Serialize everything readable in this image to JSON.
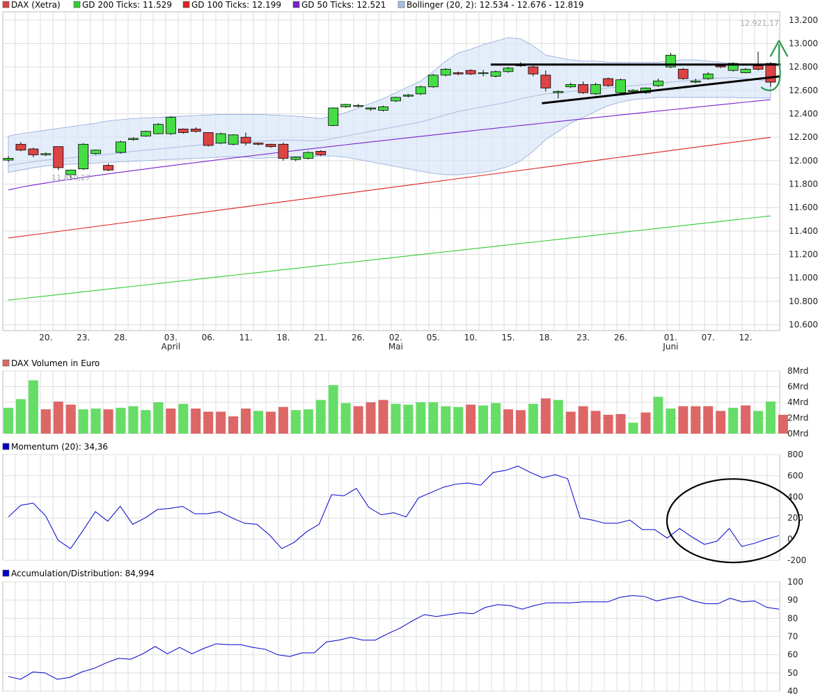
{
  "legend": {
    "dax": {
      "label": "DAX (Xetra)",
      "color": "#dd4444"
    },
    "gd200": {
      "label": "GD 200 Ticks: 11.529",
      "color": "#33cc33"
    },
    "gd100": {
      "label": "GD 100 Ticks: 12.199",
      "color": "#dd2222"
    },
    "gd50": {
      "label": "GD 50 Ticks: 12.521",
      "color": "#7722cc"
    },
    "bollinger": {
      "label": "Bollinger (20, 2): 12.534 - 12.676 - 12.819",
      "color": "#aac0e0"
    }
  },
  "panels": {
    "volume_title": "DAX Volumen in Euro",
    "momentum_title": "Momentum (20): 34,36",
    "ad_title": "Accumulation/Distribution: 84,994"
  },
  "annotations": {
    "high_label": "12.921,17",
    "low_label": "11.850,27"
  },
  "colors": {
    "up": "#44dd44",
    "down": "#dd4444",
    "vol_up": "#66dd66",
    "vol_down": "#dd6666",
    "line_blue": "#0000cc",
    "grid": "#dddddd"
  },
  "chart_data": [
    {
      "type": "candlestick",
      "title": "DAX (Xetra)",
      "x_tick_labels": [
        "20.",
        "23.",
        "28.",
        "03.",
        "06.",
        "11.",
        "18.",
        "21.",
        "26.",
        "02.",
        "05.",
        "10.",
        "15.",
        "18.",
        "23.",
        "26.",
        "01.",
        "07.",
        "12."
      ],
      "x_tick_index": [
        3,
        6,
        9,
        13,
        16,
        19,
        22,
        25,
        28,
        31,
        34,
        37,
        40,
        43,
        46,
        49,
        53,
        56,
        59
      ],
      "month_labels": [
        {
          "label": "April",
          "index": 13
        },
        {
          "label": "Mai",
          "index": 31
        },
        {
          "label": "Juni",
          "index": 53
        }
      ],
      "y_ticks": [
        "13.200",
        "13.000",
        "12.800",
        "12.600",
        "12.400",
        "12.200",
        "12.000",
        "11.800",
        "11.600",
        "11.400",
        "11.200",
        "11.000",
        "10.800",
        "10.600"
      ],
      "ylim": [
        10550,
        13270
      ],
      "open": [
        12005,
        12140,
        12100,
        12050,
        12120,
        11880,
        11930,
        12060,
        11960,
        12070,
        12180,
        12210,
        12230,
        12230,
        12270,
        12270,
        12240,
        12150,
        12140,
        12200,
        12150,
        12140,
        12140,
        12010,
        12020,
        12080,
        12300,
        12460,
        12470,
        12440,
        12430,
        12510,
        12550,
        12570,
        12630,
        12730,
        12750,
        12770,
        12750,
        12720,
        12760,
        12820,
        12800,
        12730,
        12580,
        12630,
        12650,
        12570,
        12700,
        12580,
        12590,
        12580,
        12640,
        12800,
        12780,
        12670,
        12700,
        12810,
        12770,
        12750,
        12810,
        12830
      ],
      "close": [
        12020,
        12090,
        12050,
        12060,
        11940,
        11920,
        12140,
        12090,
        11920,
        12160,
        12190,
        12250,
        12310,
        12370,
        12240,
        12250,
        12130,
        12230,
        12220,
        12150,
        12140,
        12120,
        12020,
        12030,
        12070,
        12050,
        12450,
        12480,
        12470,
        12450,
        12460,
        12540,
        12560,
        12630,
        12730,
        12780,
        12740,
        12740,
        12750,
        12760,
        12790,
        12810,
        12740,
        12620,
        12590,
        12650,
        12580,
        12650,
        12640,
        12690,
        12600,
        12620,
        12680,
        12900,
        12700,
        12680,
        12740,
        12800,
        12830,
        12780,
        12780,
        12670
      ],
      "high": [
        12040,
        12160,
        12110,
        12070,
        12120,
        11900,
        12150,
        12095,
        11975,
        12170,
        12200,
        12255,
        12320,
        12380,
        12275,
        12285,
        12240,
        12240,
        12225,
        12240,
        12155,
        12145,
        12155,
        12035,
        12080,
        12090,
        12455,
        12485,
        12485,
        12455,
        12470,
        12545,
        12570,
        12640,
        12740,
        12790,
        12760,
        12780,
        12775,
        12770,
        12800,
        12840,
        12810,
        12770,
        12600,
        12665,
        12675,
        12665,
        12710,
        12700,
        12610,
        12625,
        12700,
        12920,
        12790,
        12700,
        12755,
        12820,
        12840,
        12790,
        12930,
        12840
      ],
      "low": [
        11990,
        12080,
        12030,
        12040,
        11920,
        11850,
        11920,
        12050,
        11910,
        12060,
        12170,
        12205,
        12225,
        12220,
        12230,
        12240,
        12120,
        12140,
        12130,
        12130,
        12130,
        12110,
        12000,
        11995,
        12010,
        12040,
        12295,
        12450,
        12455,
        12425,
        12420,
        12500,
        12540,
        12560,
        12620,
        12720,
        12730,
        12730,
        12720,
        12710,
        12750,
        12800,
        12720,
        12590,
        12530,
        12620,
        12570,
        12560,
        12630,
        12570,
        12580,
        12570,
        12630,
        12790,
        12690,
        12660,
        12690,
        12790,
        12760,
        12745,
        12770,
        12630
      ],
      "overlays": [
        {
          "name": "GD 200 Ticks",
          "from": 10810,
          "to": 11529
        },
        {
          "name": "GD 100 Ticks",
          "from": 11340,
          "to": 12199
        },
        {
          "name": "GD 50 Ticks",
          "from": 11750,
          "to": 12521
        }
      ],
      "bollinger_mid": [
        11960,
        11975,
        11990,
        12005,
        12015,
        12025,
        12035,
        12045,
        12055,
        12065,
        12080,
        12090,
        12100,
        12110,
        12120,
        12130,
        12140,
        12150,
        12160,
        12165,
        12165,
        12170,
        12175,
        12175,
        12170,
        12170,
        12190,
        12210,
        12230,
        12250,
        12270,
        12290,
        12310,
        12330,
        12360,
        12390,
        12420,
        12440,
        12460,
        12480,
        12500,
        12530,
        12550,
        12570,
        12580,
        12590,
        12600,
        12610,
        12620,
        12630,
        12640,
        12650,
        12660,
        12670,
        12680,
        12690,
        12700,
        12705,
        12710,
        12700,
        12690,
        12676
      ],
      "bollinger_upper": [
        12210,
        12230,
        12245,
        12260,
        12275,
        12290,
        12305,
        12320,
        12340,
        12350,
        12360,
        12365,
        12370,
        12375,
        12380,
        12385,
        12390,
        12395,
        12395,
        12395,
        12395,
        12390,
        12385,
        12380,
        12370,
        12360,
        12380,
        12410,
        12450,
        12490,
        12530,
        12580,
        12630,
        12680,
        12760,
        12850,
        12920,
        12950,
        12990,
        13020,
        13050,
        13040,
        12980,
        12900,
        12880,
        12860,
        12850,
        12850,
        12840,
        12840,
        12840,
        12840,
        12840,
        12850,
        12860,
        12860,
        12850,
        12840,
        12830,
        12820,
        12820,
        12819
      ],
      "bollinger_lower": [
        11900,
        11920,
        11940,
        11955,
        11965,
        11970,
        11975,
        11980,
        11985,
        11990,
        11995,
        12000,
        12005,
        12010,
        12015,
        12020,
        12025,
        12030,
        12035,
        12030,
        12020,
        12025,
        12030,
        12035,
        12035,
        12040,
        12040,
        12030,
        12010,
        11990,
        11970,
        11950,
        11930,
        11910,
        11890,
        11880,
        11880,
        11890,
        11900,
        11920,
        11950,
        12000,
        12080,
        12180,
        12250,
        12320,
        12370,
        12420,
        12470,
        12500,
        12520,
        12530,
        12540,
        12540,
        12540,
        12540,
        12540,
        12540,
        12540,
        12535,
        12535,
        12534
      ],
      "trendlines": [
        {
          "from_index": 38.6,
          "from_value": 12820,
          "to_index": 61.8,
          "to_value": 12820,
          "color": "#000000"
        },
        {
          "from_index": 42.7,
          "from_value": 12490,
          "to_index": 61.8,
          "to_value": 12720,
          "color": "#000000"
        }
      ],
      "arrows": [
        {
          "color": "#2a9a4a",
          "anchor_index": 61.5,
          "from_value": 12600,
          "to_value": 13000
        }
      ]
    },
    {
      "type": "bar",
      "title": "DAX Volumen in Euro",
      "y_ticks": [
        "8Mrd",
        "6Mrd",
        "4Mrd",
        "2Mrd",
        "0Mrd"
      ],
      "ylim": [
        0,
        8
      ],
      "unit": "Mrd",
      "values": [
        3.3,
        4.4,
        6.8,
        3.1,
        4.1,
        3.7,
        3.1,
        3.2,
        3.1,
        3.3,
        3.5,
        3.0,
        4.0,
        3.2,
        3.8,
        3.2,
        2.8,
        2.8,
        2.2,
        3.2,
        2.9,
        2.8,
        3.4,
        3.0,
        3.1,
        4.3,
        6.2,
        3.9,
        3.5,
        4.0,
        4.3,
        3.8,
        3.7,
        4.0,
        4.0,
        3.5,
        3.4,
        3.7,
        3.6,
        3.9,
        3.1,
        3.0,
        3.8,
        4.5,
        4.3,
        2.8,
        3.5,
        2.9,
        2.4,
        2.5,
        1.4,
        2.7,
        4.7,
        3.2,
        3.5,
        3.5,
        3.5,
        2.9,
        3.3,
        3.6,
        2.9,
        4.1,
        2.4
      ],
      "up": [
        1,
        1,
        1,
        0,
        0,
        0,
        1,
        1,
        0,
        1,
        1,
        1,
        1,
        0,
        1,
        0,
        0,
        0,
        0,
        0,
        1,
        0,
        0,
        1,
        1,
        1,
        1,
        1,
        0,
        0,
        0,
        1,
        1,
        1,
        1,
        1,
        1,
        0,
        1,
        1,
        0,
        0,
        1,
        0,
        1,
        0,
        0,
        0,
        0,
        0,
        1,
        0,
        1,
        1,
        0,
        0,
        0,
        0,
        1,
        0,
        1,
        1,
        0
      ]
    },
    {
      "type": "line",
      "title": "Momentum (20): 34,36",
      "y_ticks": [
        "800",
        "600",
        "400",
        "200",
        "0",
        "-200"
      ],
      "ylim": [
        -200,
        800
      ],
      "values": [
        210,
        320,
        340,
        220,
        -10,
        -90,
        80,
        260,
        170,
        310,
        140,
        200,
        280,
        290,
        310,
        240,
        240,
        260,
        200,
        150,
        140,
        40,
        -90,
        -30,
        70,
        140,
        420,
        410,
        480,
        300,
        230,
        250,
        210,
        390,
        440,
        490,
        520,
        530,
        510,
        630,
        650,
        690,
        630,
        580,
        610,
        570,
        200,
        180,
        150,
        150,
        180,
        90,
        90,
        10,
        100,
        20,
        -50,
        -20,
        100,
        -70,
        -40,
        0,
        34
      ],
      "annotation": {
        "shape": "ellipse",
        "color": "#000000",
        "center_index": 55.5,
        "center_value": 200
      }
    },
    {
      "type": "line",
      "title": "Accumulation/Distribution: 84,994",
      "y_ticks": [
        "100",
        "90",
        "80",
        "70",
        "60",
        "50",
        "40"
      ],
      "ylim": [
        40,
        100
      ],
      "values": [
        48,
        46.5,
        50.5,
        50,
        46.5,
        47.5,
        50.5,
        52.5,
        55.5,
        58,
        57.5,
        60.5,
        64.5,
        60.5,
        64,
        60.5,
        63.5,
        66,
        65.5,
        65.5,
        64,
        63,
        60,
        59,
        61,
        61,
        67,
        68,
        69.5,
        68,
        68,
        71.5,
        74.5,
        78.5,
        82,
        81,
        82,
        83,
        82.5,
        86,
        87.5,
        87,
        85,
        87,
        88.5,
        88.5,
        88.5,
        89,
        89,
        89,
        91.5,
        92.5,
        92,
        89.5,
        91,
        92,
        89.5,
        88,
        88,
        91,
        89,
        89.5,
        86,
        85
      ]
    }
  ]
}
